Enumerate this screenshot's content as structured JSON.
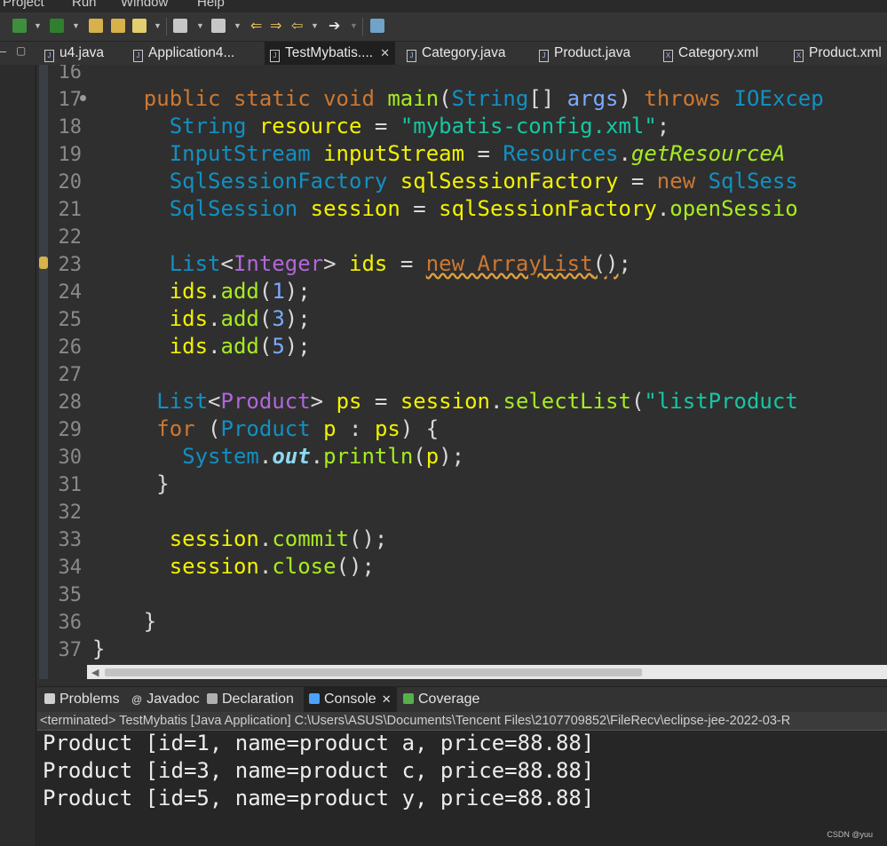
{
  "menu": [
    "Project",
    "Run",
    "Window",
    "Help"
  ],
  "tabs": [
    {
      "label": "u4.java",
      "type": "java"
    },
    {
      "label": "Application4...",
      "type": "java"
    },
    {
      "label": "TestMybatis....",
      "type": "java",
      "active": true
    },
    {
      "label": "Category.java",
      "type": "java"
    },
    {
      "label": "Product.java",
      "type": "java"
    },
    {
      "label": "Category.xml",
      "type": "xml"
    },
    {
      "label": "Product.xml",
      "type": "xml"
    }
  ],
  "tab_close_glyph": "✕",
  "editor": {
    "line_numbers": [
      "16",
      "17",
      "18",
      "19",
      "20",
      "21",
      "22",
      "23",
      "24",
      "25",
      "26",
      "27",
      "28",
      "29",
      "30",
      "31",
      "32",
      "33",
      "34",
      "35",
      "36",
      "37"
    ],
    "lines": [
      [],
      [
        {
          "t": "    ",
          "c": "pl"
        },
        {
          "t": "public",
          "c": "kw"
        },
        {
          "t": " ",
          "c": "pl"
        },
        {
          "t": "static",
          "c": "kw"
        },
        {
          "t": " ",
          "c": "pl"
        },
        {
          "t": "void",
          "c": "kw"
        },
        {
          "t": " ",
          "c": "pl"
        },
        {
          "t": "main",
          "c": "mt"
        },
        {
          "t": "(",
          "c": "pl"
        },
        {
          "t": "String",
          "c": "ty"
        },
        {
          "t": "[] ",
          "c": "pl"
        },
        {
          "t": "args",
          "c": "nv"
        },
        {
          "t": ") ",
          "c": "pl"
        },
        {
          "t": "throws",
          "c": "kw"
        },
        {
          "t": " ",
          "c": "pl"
        },
        {
          "t": "IOExcep",
          "c": "ty"
        }
      ],
      [
        {
          "t": "      ",
          "c": "pl"
        },
        {
          "t": "String",
          "c": "ty"
        },
        {
          "t": " ",
          "c": "pl"
        },
        {
          "t": "resource",
          "c": "vr"
        },
        {
          "t": " = ",
          "c": "pl"
        },
        {
          "t": "\"mybatis-config.xml\"",
          "c": "st"
        },
        {
          "t": ";",
          "c": "pl"
        }
      ],
      [
        {
          "t": "      ",
          "c": "pl"
        },
        {
          "t": "InputStream",
          "c": "ty"
        },
        {
          "t": " ",
          "c": "pl"
        },
        {
          "t": "inputStream",
          "c": "vr"
        },
        {
          "t": " = ",
          "c": "pl"
        },
        {
          "t": "Resources",
          "c": "ty"
        },
        {
          "t": ".",
          "c": "pl"
        },
        {
          "t": "getResourceA",
          "c": "it"
        }
      ],
      [
        {
          "t": "      ",
          "c": "pl"
        },
        {
          "t": "SqlSessionFactory",
          "c": "ty"
        },
        {
          "t": " ",
          "c": "pl"
        },
        {
          "t": "sqlSessionFactory",
          "c": "vr"
        },
        {
          "t": " = ",
          "c": "pl"
        },
        {
          "t": "new",
          "c": "kw"
        },
        {
          "t": " ",
          "c": "pl"
        },
        {
          "t": "SqlSess",
          "c": "ty"
        }
      ],
      [
        {
          "t": "      ",
          "c": "pl"
        },
        {
          "t": "SqlSession",
          "c": "ty"
        },
        {
          "t": " ",
          "c": "pl"
        },
        {
          "t": "session",
          "c": "vr"
        },
        {
          "t": " = ",
          "c": "pl"
        },
        {
          "t": "sqlSessionFactory",
          "c": "vr"
        },
        {
          "t": ".",
          "c": "pl"
        },
        {
          "t": "openSessio",
          "c": "mt"
        }
      ],
      [],
      [
        {
          "t": "      ",
          "c": "pl"
        },
        {
          "t": "List",
          "c": "ty"
        },
        {
          "t": "<",
          "c": "pl"
        },
        {
          "t": "Integer",
          "c": "tp"
        },
        {
          "t": "> ",
          "c": "pl"
        },
        {
          "t": "ids",
          "c": "vr"
        },
        {
          "t": " = ",
          "c": "pl"
        },
        {
          "t": "new ArrayList",
          "c": "kw squig"
        },
        {
          "t": "()",
          "c": "pl squig"
        },
        {
          "t": ";",
          "c": "pl"
        }
      ],
      [
        {
          "t": "      ",
          "c": "pl"
        },
        {
          "t": "ids",
          "c": "vr"
        },
        {
          "t": ".",
          "c": "pl"
        },
        {
          "t": "add",
          "c": "mt"
        },
        {
          "t": "(",
          "c": "pl"
        },
        {
          "t": "1",
          "c": "nv"
        },
        {
          "t": ");",
          "c": "pl"
        }
      ],
      [
        {
          "t": "      ",
          "c": "pl"
        },
        {
          "t": "ids",
          "c": "vr"
        },
        {
          "t": ".",
          "c": "pl"
        },
        {
          "t": "add",
          "c": "mt"
        },
        {
          "t": "(",
          "c": "pl"
        },
        {
          "t": "3",
          "c": "nv"
        },
        {
          "t": ");",
          "c": "pl"
        }
      ],
      [
        {
          "t": "      ",
          "c": "pl"
        },
        {
          "t": "ids",
          "c": "vr"
        },
        {
          "t": ".",
          "c": "pl"
        },
        {
          "t": "add",
          "c": "mt"
        },
        {
          "t": "(",
          "c": "pl"
        },
        {
          "t": "5",
          "c": "nv"
        },
        {
          "t": ");",
          "c": "pl"
        }
      ],
      [],
      [
        {
          "t": "     ",
          "c": "pl"
        },
        {
          "t": "List",
          "c": "ty"
        },
        {
          "t": "<",
          "c": "pl"
        },
        {
          "t": "Product",
          "c": "tp"
        },
        {
          "t": "> ",
          "c": "pl"
        },
        {
          "t": "ps",
          "c": "vr"
        },
        {
          "t": " = ",
          "c": "pl"
        },
        {
          "t": "session",
          "c": "vr"
        },
        {
          "t": ".",
          "c": "pl"
        },
        {
          "t": "selectList",
          "c": "mt"
        },
        {
          "t": "(",
          "c": "pl"
        },
        {
          "t": "\"listProduct",
          "c": "st"
        }
      ],
      [
        {
          "t": "     ",
          "c": "pl"
        },
        {
          "t": "for",
          "c": "kw"
        },
        {
          "t": " (",
          "c": "pl"
        },
        {
          "t": "Product",
          "c": "ty"
        },
        {
          "t": " ",
          "c": "pl"
        },
        {
          "t": "p",
          "c": "vr"
        },
        {
          "t": " : ",
          "c": "pl"
        },
        {
          "t": "ps",
          "c": "vr"
        },
        {
          "t": ") {",
          "c": "pl"
        }
      ],
      [
        {
          "t": "       ",
          "c": "pl"
        },
        {
          "t": "System",
          "c": "ty"
        },
        {
          "t": ".",
          "c": "pl"
        },
        {
          "t": "out",
          "c": "fl"
        },
        {
          "t": ".",
          "c": "pl"
        },
        {
          "t": "println",
          "c": "mt"
        },
        {
          "t": "(",
          "c": "pl"
        },
        {
          "t": "p",
          "c": "vr"
        },
        {
          "t": ");",
          "c": "pl"
        }
      ],
      [
        {
          "t": "     }",
          "c": "pl"
        }
      ],
      [],
      [
        {
          "t": "      ",
          "c": "pl"
        },
        {
          "t": "session",
          "c": "vr"
        },
        {
          "t": ".",
          "c": "pl"
        },
        {
          "t": "commit",
          "c": "mt"
        },
        {
          "t": "();",
          "c": "pl"
        }
      ],
      [
        {
          "t": "      ",
          "c": "pl"
        },
        {
          "t": "session",
          "c": "vr"
        },
        {
          "t": ".",
          "c": "pl"
        },
        {
          "t": "close",
          "c": "mt"
        },
        {
          "t": "();",
          "c": "pl"
        }
      ],
      [],
      [
        {
          "t": "    }",
          "c": "pl"
        }
      ],
      [
        {
          "t": "}",
          "c": "pl"
        }
      ]
    ]
  },
  "views": [
    {
      "label": "Problems",
      "icon": "problems-icon",
      "color": "#d0d0d0"
    },
    {
      "label": "Javadoc",
      "icon": "javadoc-icon",
      "color": "#ececec"
    },
    {
      "label": "Declaration",
      "icon": "declaration-icon",
      "color": "#b0b0b0"
    },
    {
      "label": "Console",
      "icon": "console-icon",
      "color": "#4aa3ff",
      "active": true
    },
    {
      "label": "Coverage",
      "icon": "coverage-icon",
      "color": "#55b049"
    }
  ],
  "console": {
    "terminated": "<terminated> TestMybatis [Java Application] C:\\Users\\ASUS\\Documents\\Tencent Files\\2107709852\\FileRecv\\eclipse-jee-2022-03-R",
    "output": [
      "Product [id=1, name=product a, price=88.88]",
      "Product [id=3, name=product c, price=88.88]",
      "Product [id=5, name=product y, price=88.88]"
    ]
  },
  "watermark": "CSDN @yuu",
  "colors": {
    "accent": "#4d77d6",
    "keyword": "#cc7832",
    "type": "#1290c3",
    "variable": "#f2f200"
  }
}
